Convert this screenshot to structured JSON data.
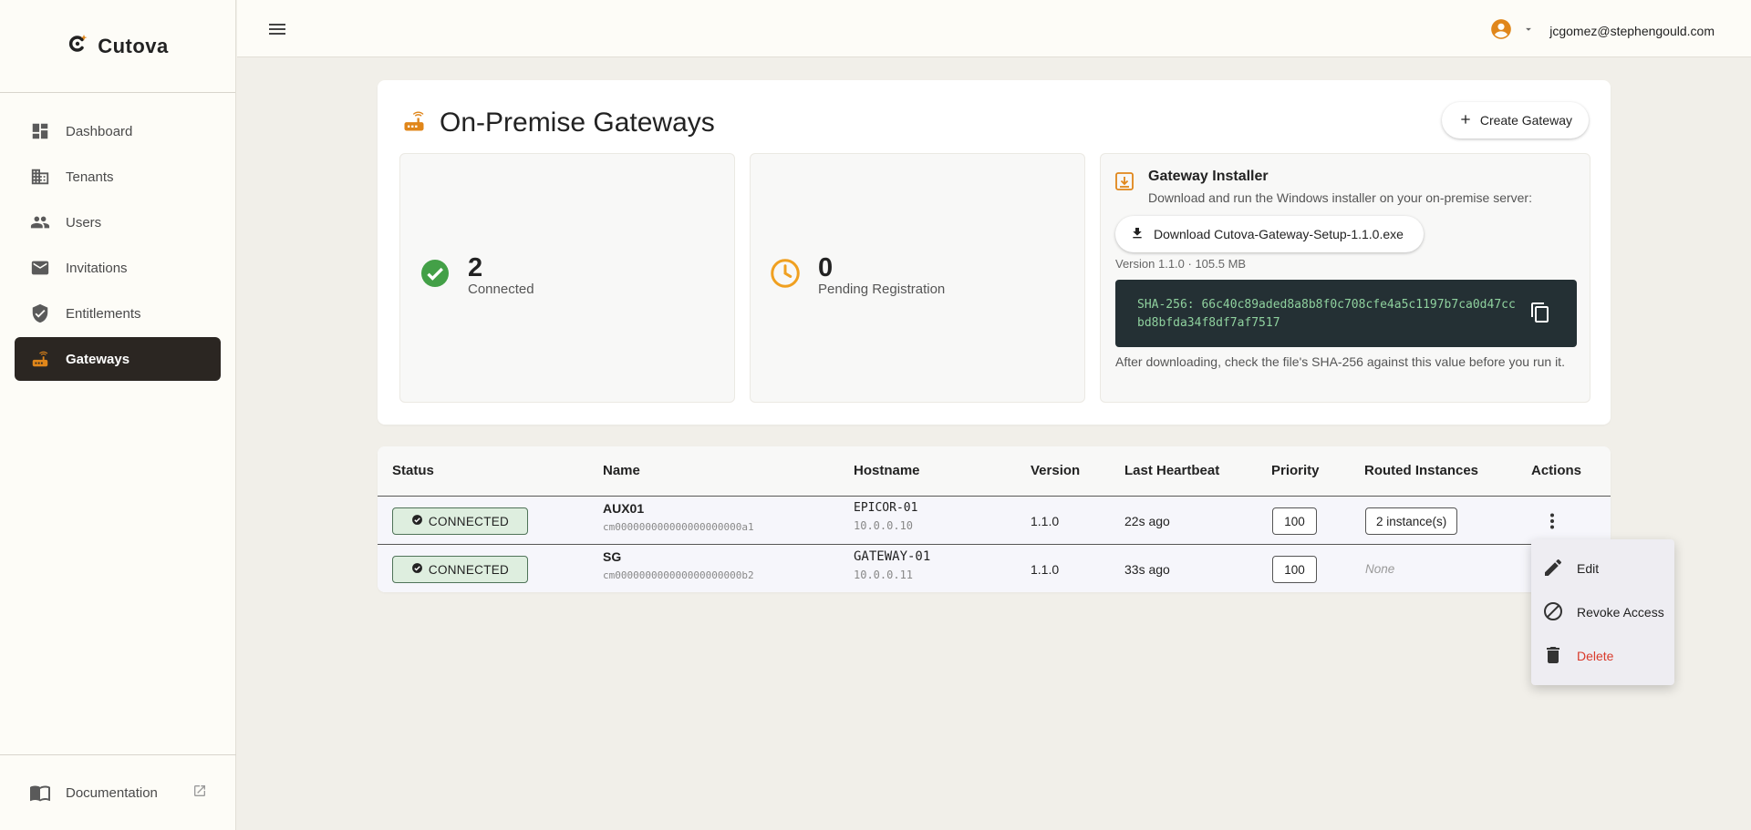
{
  "brand": {
    "name": "Cutova",
    "accent": "#e0861a"
  },
  "sidebar": {
    "items": [
      {
        "label": "Dashboard",
        "icon": "dashboard-icon"
      },
      {
        "label": "Tenants",
        "icon": "building-icon"
      },
      {
        "label": "Users",
        "icon": "users-icon"
      },
      {
        "label": "Invitations",
        "icon": "mail-icon"
      },
      {
        "label": "Entitlements",
        "icon": "shield-icon"
      },
      {
        "label": "Gateways",
        "icon": "router-icon",
        "active": true
      }
    ],
    "footer": {
      "label": "Documentation",
      "icon": "book-icon"
    }
  },
  "topbar": {
    "user_email": "jcgomez@stephengould.com"
  },
  "page": {
    "title": "On-Premise Gateways",
    "create_label": "Create Gateway"
  },
  "stats": {
    "connected": {
      "value": "2",
      "label": "Connected"
    },
    "pending": {
      "value": "0",
      "label": "Pending Registration"
    }
  },
  "installer": {
    "title": "Gateway Installer",
    "description": "Download and run the Windows installer on your on-premise server:",
    "download_label": "Download Cutova-Gateway-Setup-1.1.0.exe",
    "version_line": "Version 1.1.0 · 105.5 MB",
    "sha": "SHA-256: 66c40c89aded8a8b8f0c708cfe4a5c1197b7ca0d47ccbd8bfda34f8df7af7517",
    "after_note": "After downloading, check the file's SHA-256 against this value before you run it."
  },
  "table": {
    "columns": [
      "Status",
      "Name",
      "Hostname",
      "Version",
      "Last Heartbeat",
      "Priority",
      "Routed Instances",
      "Actions"
    ],
    "rows": [
      {
        "status": "CONNECTED",
        "name": "AUX01",
        "id": "cm000000000000000000000a1",
        "hostname": "EPICOR-01",
        "ip": "10.0.0.10",
        "version": "1.1.0",
        "heartbeat": "22s ago",
        "priority": "100",
        "routed": "2 instance(s)"
      },
      {
        "status": "CONNECTED",
        "name": "SG",
        "id": "cm000000000000000000000b2",
        "hostname": "GATEWAY-01",
        "ip": "10.0.0.11",
        "version": "1.1.0",
        "heartbeat": "33s ago",
        "priority": "100",
        "routed": "None"
      }
    ]
  },
  "menu": {
    "items": [
      {
        "label": "Edit",
        "icon": "pencil-icon"
      },
      {
        "label": "Revoke Access",
        "icon": "block-icon"
      },
      {
        "label": "Delete",
        "icon": "trash-icon",
        "danger_color": "#d93a2b"
      }
    ]
  }
}
